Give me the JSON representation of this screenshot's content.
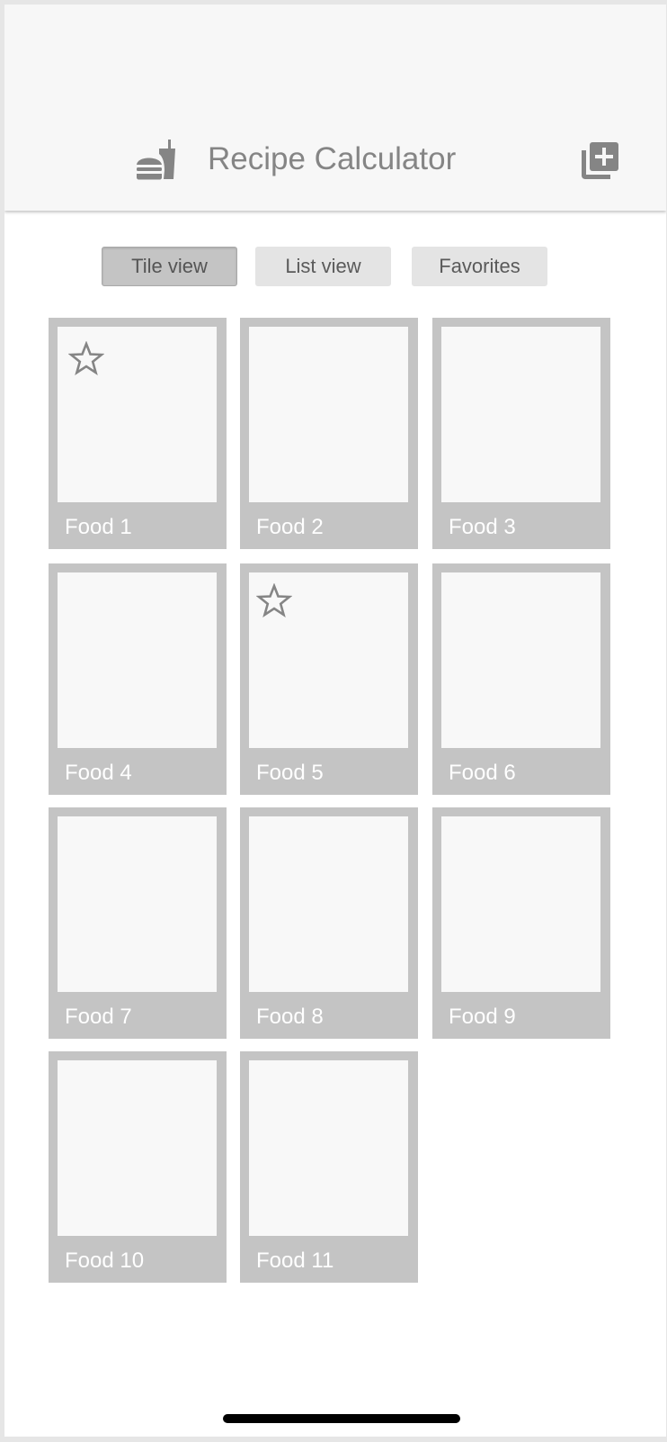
{
  "colors": {
    "app_bar_bg": "#f7f7f7",
    "icon_gray": "#858585",
    "tile_frame": "#c4c4c4",
    "tile_image": "#f8f8f8",
    "home_indicator": "#000000"
  },
  "header": {
    "title": "Recipe Calculator",
    "app_icon": "fastfood-icon",
    "add_icon": "library-add-icon"
  },
  "view_toggle": {
    "tile_view": "Tile view",
    "list_view": "List view",
    "favorites": "Favorites",
    "selected": "Tile view"
  },
  "foods": [
    {
      "label": "Food 1",
      "favorite": true
    },
    {
      "label": "Food 2",
      "favorite": false
    },
    {
      "label": "Food 3",
      "favorite": false
    },
    {
      "label": "Food 4",
      "favorite": false
    },
    {
      "label": "Food 5",
      "favorite": true
    },
    {
      "label": "Food 6",
      "favorite": false
    },
    {
      "label": "Food 7",
      "favorite": false
    },
    {
      "label": "Food 8",
      "favorite": false
    },
    {
      "label": "Food 9",
      "favorite": false
    },
    {
      "label": "Food 10",
      "favorite": false
    },
    {
      "label": "Food 11",
      "favorite": false
    }
  ],
  "favorite_icon": "star-outline-icon"
}
